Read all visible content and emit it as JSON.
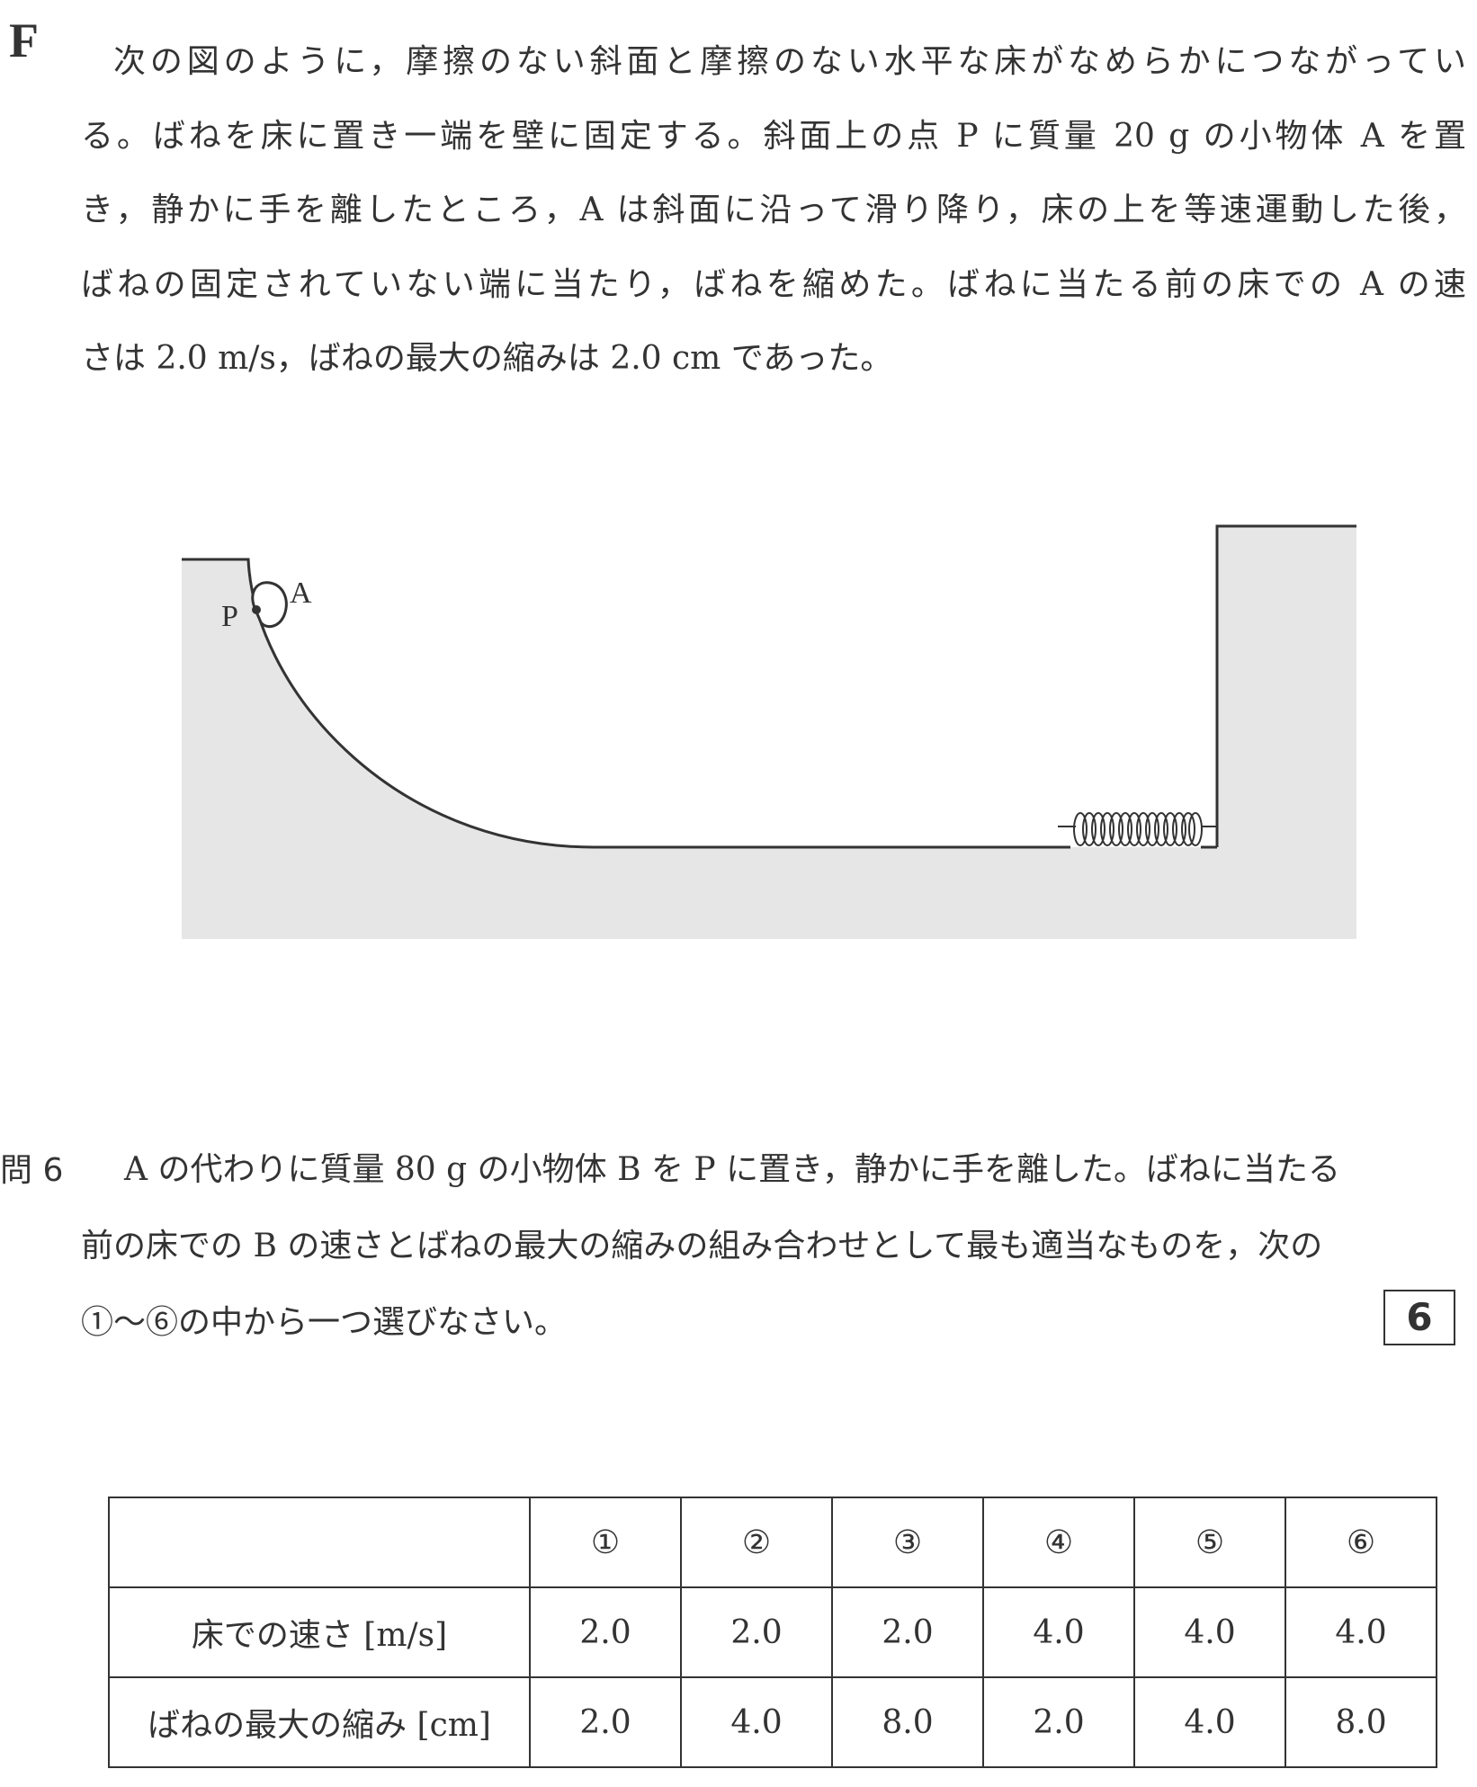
{
  "section": {
    "letter": "F"
  },
  "intro": {
    "lines": [
      "次の図のように，摩擦のない斜面と摩擦のない水平な床がなめらかにつながってい",
      "る。ばねを床に置き一端を壁に固定する。斜面上の点 P に質量 20 g の小物体 A を置",
      "き，静かに手を離したところ，A は斜面に沿って滑り降り，床の上を等速運動した後，",
      "ばねの固定されていない端に当たり，ばねを縮めた。ばねに当たる前の床での A の速",
      "さは 2.0 m/s，ばねの最大の縮みは 2.0 cm であった。"
    ]
  },
  "figure": {
    "label_p": "P",
    "label_a": "A",
    "colors": {
      "ground": "#e6e6e6",
      "line": "#333333"
    }
  },
  "question": {
    "label": "問 6",
    "lines": [
      "A の代わりに質量 80 g の小物体 B を P に置き，静かに手を離した。ばねに当たる",
      "前の床での B の速さとばねの最大の縮みの組み合わせとして最も適当なものを，次の",
      "①〜⑥の中から一つ選びなさい。"
    ],
    "answer_box": "6"
  },
  "table": {
    "headers": [
      "",
      "①",
      "②",
      "③",
      "④",
      "⑤",
      "⑥"
    ],
    "rows": [
      {
        "label": "床での速さ [m/s]",
        "values": [
          "2.0",
          "2.0",
          "2.0",
          "4.0",
          "4.0",
          "4.0"
        ]
      },
      {
        "label": "ばねの最大の縮み [cm]",
        "values": [
          "2.0",
          "4.0",
          "8.0",
          "2.0",
          "4.0",
          "8.0"
        ]
      }
    ]
  }
}
